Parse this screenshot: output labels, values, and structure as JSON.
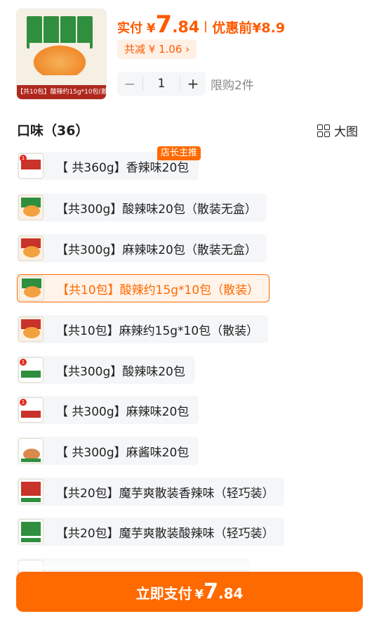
{
  "product": {
    "caption": "【共10包】酸辣约15g*10包(散装)"
  },
  "price": {
    "paid_label": "实付",
    "currency": "¥",
    "paid_int": "7",
    "paid_dec": ".84",
    "before_label": "优惠前",
    "before_value": "¥8.9",
    "discount_text": "共减 ¥ 1.06 ›"
  },
  "quantity": {
    "minus": "−",
    "value": "1",
    "plus": "+",
    "limit": "限购2件"
  },
  "flavors": {
    "title": "口味（36）",
    "view_label": "大图",
    "badge": "店长主推",
    "items": [
      {
        "label": "【 共360g】香辣味20包"
      },
      {
        "label": "【共300g】酸辣味20包（散装无盒）"
      },
      {
        "label": "【共300g】麻辣味20包（散装无盒）"
      },
      {
        "label": "【共10包】酸辣约15g*10包（散装）"
      },
      {
        "label": "【共10包】麻辣约15g*10包（散装）"
      },
      {
        "label": "【共300g】酸辣味20包"
      },
      {
        "label": "【 共300g】麻辣味20包"
      },
      {
        "label": "【 共300g】麻酱味20包"
      },
      {
        "label": "【共20包】魔芋爽散装香辣味（轻巧装）"
      },
      {
        "label": "【共20包】魔芋爽散装酸辣味（轻巧装）"
      }
    ],
    "selected_index": 3
  },
  "pay_button": {
    "label": "立即支付",
    "currency": "¥",
    "int": "7",
    "dec": ".84"
  },
  "colors": {
    "accent": "#ff6a00"
  }
}
